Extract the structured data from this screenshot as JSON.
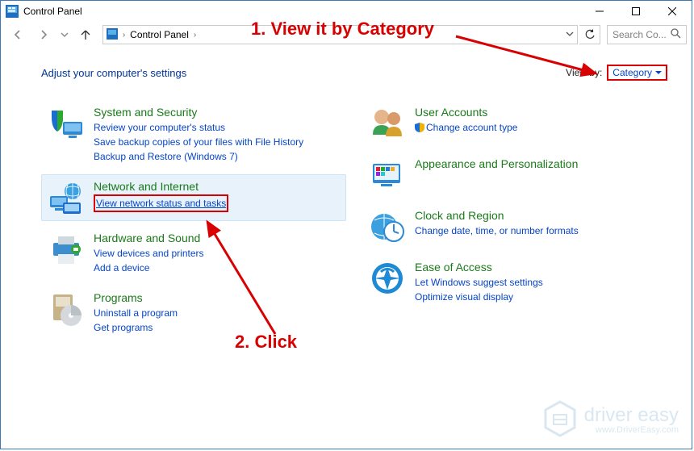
{
  "window": {
    "title": "Control Panel"
  },
  "nav": {
    "breadcrumb": "Control Panel",
    "chev": "›"
  },
  "search": {
    "placeholder": "Search Co..."
  },
  "heading": "Adjust your computer's settings",
  "viewby": {
    "label": "View by:",
    "value": "Category"
  },
  "left": [
    {
      "title": "System and Security",
      "links": [
        "Review your computer's status",
        "Save backup copies of your files with File History",
        "Backup and Restore (Windows 7)"
      ]
    },
    {
      "title": "Network and Internet",
      "links": [
        "View network status and tasks"
      ],
      "highlight": true,
      "link_boxed": true
    },
    {
      "title": "Hardware and Sound",
      "links": [
        "View devices and printers",
        "Add a device"
      ]
    },
    {
      "title": "Programs",
      "links": [
        "Uninstall a program",
        "Get programs"
      ]
    }
  ],
  "right": [
    {
      "title": "User Accounts",
      "links": [
        "Change account type"
      ],
      "shield": true
    },
    {
      "title": "Appearance and Personalization",
      "links": []
    },
    {
      "title": "Clock and Region",
      "links": [
        "Change date, time, or number formats"
      ]
    },
    {
      "title": "Ease of Access",
      "links": [
        "Let Windows suggest settings",
        "Optimize visual display"
      ]
    }
  ],
  "annotations": {
    "step1": "1. View it by Category",
    "step2": "2. Click"
  },
  "watermark": {
    "brand": "driver easy",
    "url": "www.DriverEasy.com"
  },
  "colors": {
    "red": "#d80000",
    "link": "#0645c8",
    "green": "#1a7a1a"
  }
}
